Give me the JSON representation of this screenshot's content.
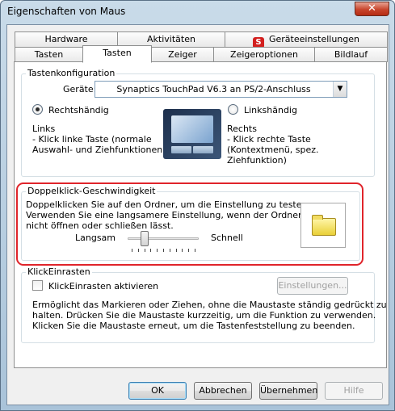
{
  "window": {
    "title": "Eigenschaften von Maus",
    "close_glyph": "✕"
  },
  "tabs": {
    "row_back": [
      {
        "label": "Hardware"
      },
      {
        "label": "Aktivitäten"
      },
      {
        "label": "Geräteeinstellungen",
        "icon": "synaptics-icon"
      }
    ],
    "row_front": [
      {
        "label": "Tasten"
      },
      {
        "label": "Tasten",
        "active": true
      },
      {
        "label": "Zeiger"
      },
      {
        "label": "Zeigeroptionen"
      },
      {
        "label": "Bildlauf"
      }
    ]
  },
  "button_config": {
    "group_title": "Tastenkonfiguration",
    "device_label": "Geräte:",
    "device_value": "Synaptics TouchPad V6.3 an PS/2-Anschluss",
    "right_handed_label": "Rechtshändig",
    "left_handed_label": "Linkshändig",
    "selected": "Rechtshändig",
    "left_heading": "Links",
    "left_desc_1": " - Klick linke Taste (normale",
    "left_desc_2": "Auswahl- und Ziehfunktionen)",
    "right_heading": "Rechts",
    "right_desc_1": " - Klick rechte Taste",
    "right_desc_2": "(Kontextmenü, spez.",
    "right_desc_3": "Ziehfunktion)"
  },
  "double_click": {
    "group_title": "Doppelklick-Geschwindigkeit",
    "desc_1": "Doppelklicken Sie auf den Ordner, um die Einstellung zu testen.",
    "desc_2": "Verwenden Sie eine langsamere Einstellung, wenn der Ordner sich",
    "desc_3": "nicht öffnen oder schließen lässt.",
    "slow_label": "Langsam",
    "fast_label": "Schnell",
    "slider_value": 0.2,
    "highlight_color": "#e0242b"
  },
  "click_lock": {
    "group_title": "KlickEinrasten",
    "checkbox_label": "KlickEinrasten aktivieren",
    "checked": false,
    "settings_button": "Einstellungen...",
    "desc_1": "Ermöglicht das Markieren oder Ziehen, ohne die Maustaste ständig gedrückt zu",
    "desc_2": "halten. Drücken Sie die Maustaste kurzzeitig, um die Funktion zu verwenden.",
    "desc_3": "Klicken Sie die Maustaste erneut, um die Tastenfeststellung zu beenden."
  },
  "footer": {
    "ok": "OK",
    "cancel": "Abbrechen",
    "apply": "Übernehmen",
    "help": "Hilfe"
  }
}
